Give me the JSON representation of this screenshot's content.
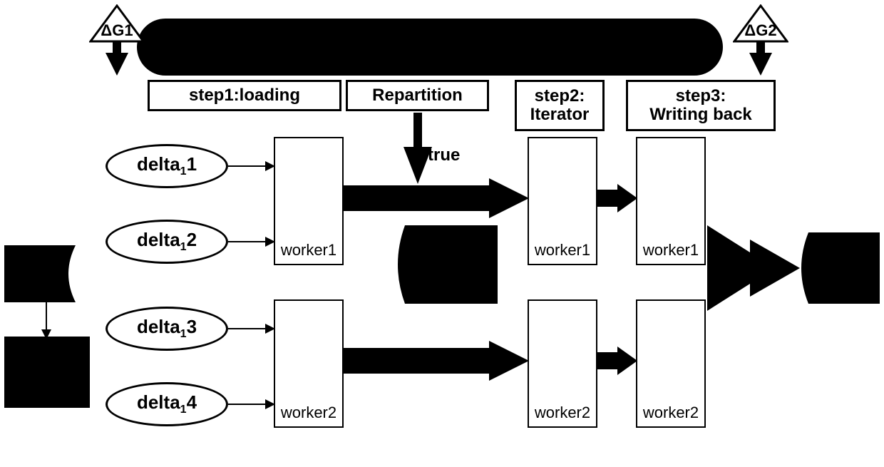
{
  "triangles": {
    "g1": "ΔG1",
    "g2": "ΔG2"
  },
  "steps": {
    "loading": "step1:loading",
    "repartition": "Repartition",
    "iterator_l1": "step2:",
    "iterator_l2": "Iterator",
    "writing_l1": "step3:",
    "writing_l2": "Writing back"
  },
  "deltas": {
    "d1": "1",
    "d2": "2",
    "d3": "3",
    "d4": "4",
    "prefix": "delta"
  },
  "workers": {
    "w1": "worker1",
    "w2": "worker2"
  },
  "labels": {
    "true": "true"
  }
}
